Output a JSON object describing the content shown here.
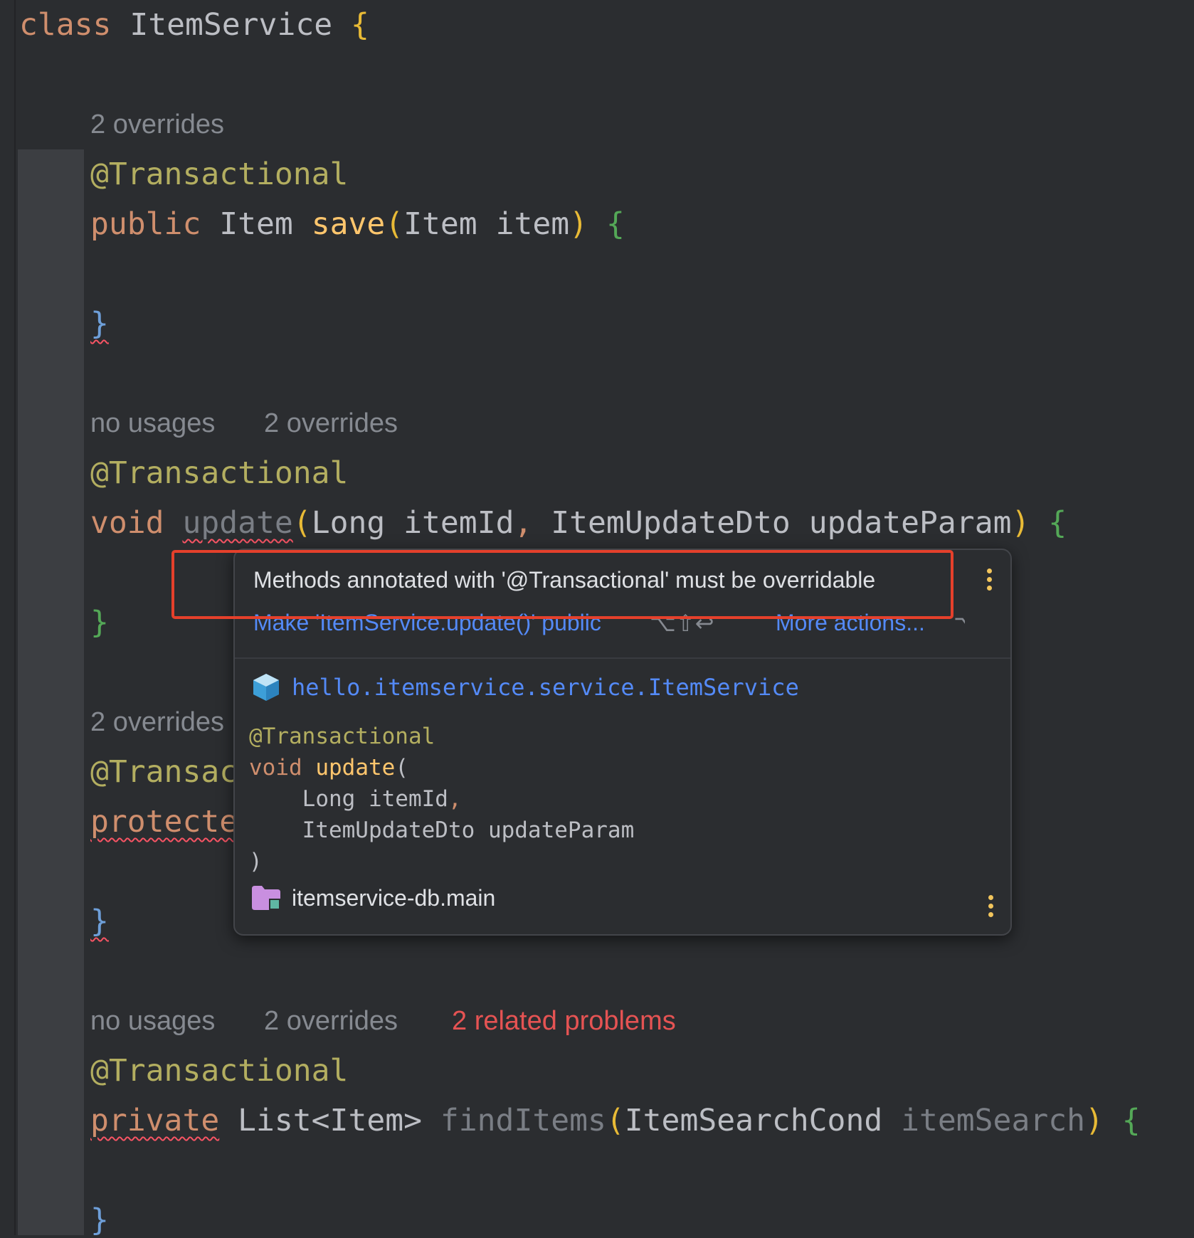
{
  "editor": {
    "line1": {
      "kw": "class",
      "name": "ItemService",
      "brace": "{"
    },
    "m1": {
      "hint_overrides": "2 overrides",
      "annotation": "@Transactional",
      "mod": "public",
      "ret": "Item",
      "name": "save",
      "open": "(",
      "ptype": "Item",
      "pname": "item",
      "close": ")",
      "brace_open": "{",
      "brace_close": "}"
    },
    "m2": {
      "hint_usages": "no usages",
      "hint_overrides": "2 overrides",
      "annotation": "@Transactional",
      "ret": "void",
      "name": "update",
      "open": "(",
      "p1type": "Long",
      "p1name": "itemId",
      "comma": ",",
      "p2type": "ItemUpdateDto",
      "p2name": "updateParam",
      "close": ")",
      "brace_open": "{",
      "brace_close": "}"
    },
    "m3": {
      "hint_overrides": "2 overrides",
      "annotation": "@Transac",
      "mod": "protecte",
      "brace_close": "}"
    },
    "m4": {
      "hint_usages": "no usages",
      "hint_overrides": "2 overrides",
      "hint_problems": "2 related problems",
      "annotation": "@Transactional",
      "mod": "private",
      "ret": "List<Item>",
      "name": "findItems",
      "open": "(",
      "ptype": "ItemSearchCond",
      "pname": "itemSearch",
      "close": ")",
      "brace_open": "{",
      "brace_close": "}"
    }
  },
  "popup": {
    "message": "Methods annotated with '@Transactional' must be overridable",
    "action_primary": "Make 'ItemService.update()' public",
    "action_primary_shortcut": "⌥⇧↩",
    "action_more": "More actions...",
    "action_more_shortcut": "⌥↩",
    "class_fqn": "hello.itemservice.service.ItemService",
    "class_icon": "class-icon",
    "doc": {
      "annotation": "@Transactional",
      "ret": "void",
      "name": "update",
      "open": "(",
      "p1": "Long itemId",
      "comma": ",",
      "p2": "ItemUpdateDto updateParam",
      "close": ")"
    },
    "module": "itemservice-db.main",
    "module_icon": "module-folder-icon"
  },
  "colors": {
    "background": "#2b2d30",
    "keyword": "#cf8e6d",
    "annotation": "#b3ae60",
    "method_decl": "#ffc66d",
    "link": "#548af7",
    "error": "#e55353",
    "highlight_box": "#e5402b"
  }
}
